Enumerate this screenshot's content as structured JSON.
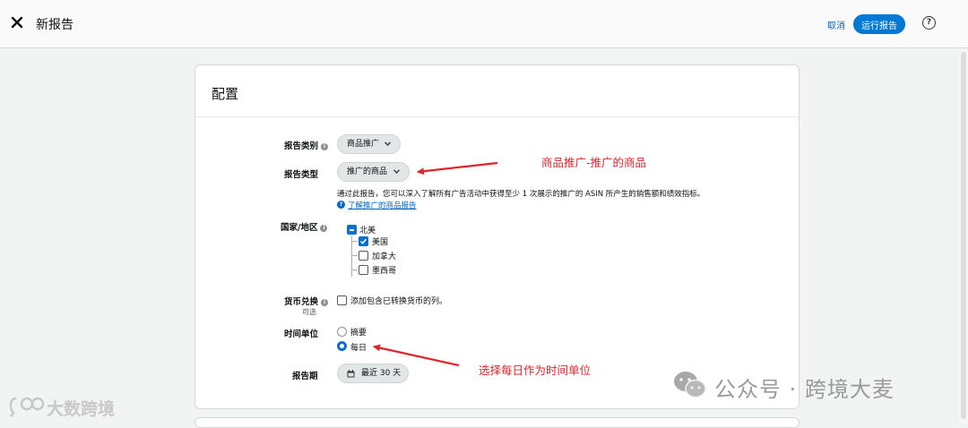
{
  "header": {
    "title": "新报告",
    "cancel_label": "取消",
    "run_label": "运行报告",
    "help_glyph": "?"
  },
  "panel": {
    "title": "配置",
    "report_category": {
      "label": "报告类别",
      "value": "商品推广"
    },
    "report_type": {
      "label": "报告类型",
      "value": "推广的商品",
      "description": "通过此报告，您可以深入了解所有广告活动中获得至少 1 次展示的推广的 ASIN 所产生的销售额和绩效指标。",
      "learn_more": "了解推广的商品报告"
    },
    "country": {
      "label": "国家/地区",
      "region": "北美",
      "items": [
        {
          "name": "美国",
          "checked": true
        },
        {
          "name": "加拿大",
          "checked": false
        },
        {
          "name": "墨西哥",
          "checked": false
        }
      ]
    },
    "currency": {
      "label": "货币兑换",
      "optional": "可选",
      "checkbox_label": "添加包含已转换货币的列。"
    },
    "time_unit": {
      "label": "时间单位",
      "options": [
        {
          "name": "摘要",
          "selected": false
        },
        {
          "name": "每日",
          "selected": true
        }
      ]
    },
    "period": {
      "label": "报告期",
      "value": "最近 30 天"
    }
  },
  "annotations": {
    "report_type_note": "商品推广-推广的商品",
    "time_unit_note": "选择每日作为时间单位"
  },
  "watermark": {
    "right": "公众号 · 跨境大麦",
    "left": "大数跨境"
  },
  "colors": {
    "accent": "#0078d4",
    "link": "#0066c0",
    "annotation_red": "#e3242b"
  }
}
